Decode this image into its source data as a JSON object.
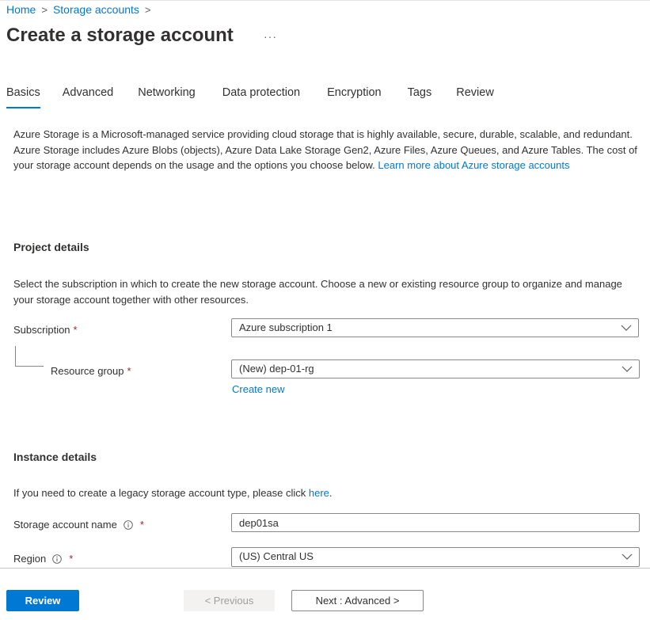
{
  "breadcrumb": {
    "home": "Home",
    "separator": ">",
    "storage_accounts": "Storage accounts"
  },
  "page": {
    "title": "Create a storage account",
    "more": "···"
  },
  "tabs": [
    {
      "label": "Basics",
      "active": true
    },
    {
      "label": "Advanced",
      "active": false
    },
    {
      "label": "Networking",
      "active": false
    },
    {
      "label": "Data protection",
      "active": false
    },
    {
      "label": "Encryption",
      "active": false
    },
    {
      "label": "Tags",
      "active": false
    },
    {
      "label": "Review",
      "active": false
    }
  ],
  "intro": {
    "text": "Azure Storage is a Microsoft-managed service providing cloud storage that is highly available, secure, durable, scalable, and redundant. Azure Storage includes Azure Blobs (objects), Azure Data Lake Storage Gen2, Azure Files, Azure Queues, and Azure Tables. The cost of your storage account depends on the usage and the options you choose below. ",
    "link": "Learn more about Azure storage accounts"
  },
  "project": {
    "title": "Project details",
    "description": "Select the subscription in which to create the new storage account. Choose a new or existing resource group to organize and manage your storage account together with other resources.",
    "subscription_label": "Subscription",
    "subscription_value": "Azure subscription 1",
    "resource_group_label": "Resource group",
    "resource_group_value": "(New) dep-01-rg",
    "create_new": "Create new"
  },
  "instance": {
    "title": "Instance details",
    "legacy_text": "If you need to create a legacy storage account type, please click ",
    "legacy_link": "here",
    "legacy_end": ".",
    "name_label": "Storage account name",
    "name_value": "dep01sa",
    "region_label": "Region",
    "region_value": "(US) Central US"
  },
  "required_marker": "*",
  "footer": {
    "review": "Review",
    "previous": "< Previous",
    "next": "Next : Advanced >"
  },
  "colors": {
    "accent": "#0078d4",
    "required": "#a4262c",
    "text": "#323130",
    "border": "#8a8886"
  }
}
